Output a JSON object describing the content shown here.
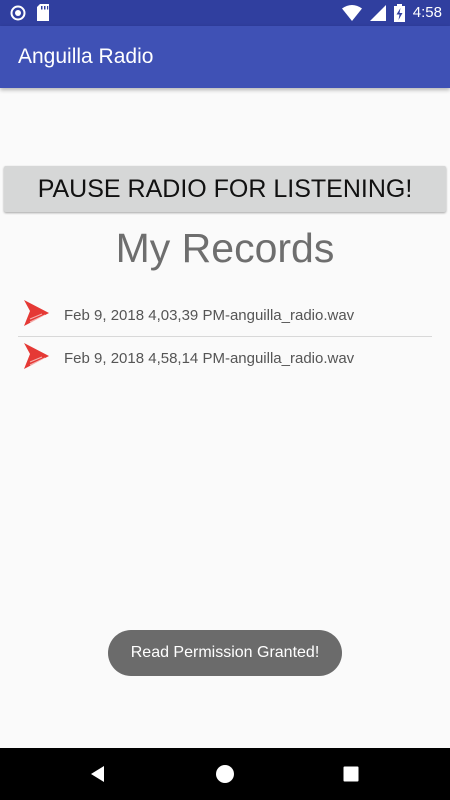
{
  "status_bar": {
    "time": "4:58",
    "icons": [
      "sync-icon",
      "sd-card-icon",
      "wifi-icon",
      "signal-icon",
      "battery-charging-icon"
    ]
  },
  "app_bar": {
    "title": "Anguilla Radio"
  },
  "pause_button": {
    "label": "PAUSE RADIO FOR LISTENING!"
  },
  "records": {
    "title": "My Records",
    "items": [
      {
        "label": "Feb 9, 2018 4,03,39 PM-anguilla_radio.wav",
        "icon": "play-icon"
      },
      {
        "label": "Feb 9, 2018 4,58,14 PM-anguilla_radio.wav",
        "icon": "play-icon"
      }
    ]
  },
  "toast": {
    "message": "Read Permission Granted!"
  },
  "nav_bar": {
    "buttons": [
      "back-icon",
      "home-icon",
      "recents-icon"
    ]
  },
  "colors": {
    "status_bar": "#303f9f",
    "app_bar": "#3f51b5",
    "background": "#fafafa",
    "button": "#d6d7d7",
    "play_icon": "#e53935",
    "toast": "#6b6b6b"
  }
}
